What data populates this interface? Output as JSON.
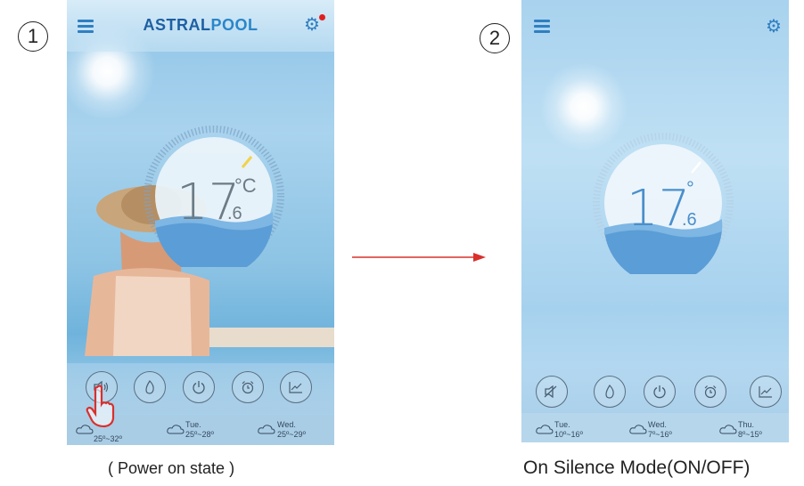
{
  "step1": {
    "number": "1",
    "caption": "( Power on state )"
  },
  "step2": {
    "number": "2",
    "caption": "On Silence Mode(ON/OFF)"
  },
  "screen1": {
    "brand_prefix": "ASTRAL",
    "brand_suffix": "POOL",
    "temperature": "17",
    "decimal": ".6",
    "unit": "°C",
    "forecast": [
      {
        "day": "",
        "range": "25º~32º"
      },
      {
        "day": "Tue.",
        "range": "25º~28º"
      },
      {
        "day": "Wed.",
        "range": "25º~29º"
      }
    ],
    "buttons": [
      "speaker-icon",
      "flame-icon",
      "power-icon",
      "alarm-clock-icon",
      "chart-icon"
    ]
  },
  "screen2": {
    "temperature": "17",
    "decimal": ".6",
    "unit": "°",
    "forecast": [
      {
        "day": "Tue.",
        "range": "10º~16º"
      },
      {
        "day": "Wed.",
        "range": "7º~16º"
      },
      {
        "day": "Thu.",
        "range": "8º~15º"
      }
    ],
    "buttons": [
      "speaker-muted-icon",
      "flame-icon",
      "power-icon",
      "alarm-clock-icon",
      "chart-icon"
    ]
  },
  "colors": {
    "accent": "#2f7fc1",
    "arrow": "#d9302c",
    "pointer": "#d9302c"
  }
}
